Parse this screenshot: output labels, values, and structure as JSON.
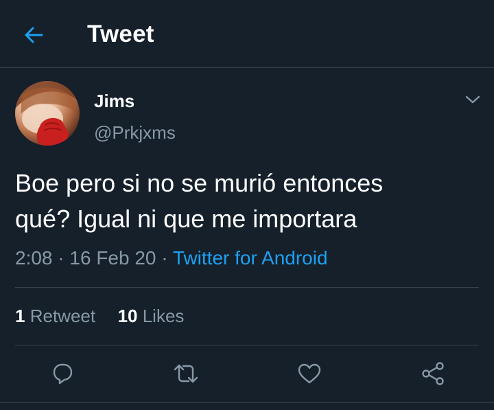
{
  "header": {
    "back_icon": "arrow-left-icon",
    "title": "Tweet"
  },
  "tweet": {
    "author": {
      "name": "Jims",
      "handle": "@Prkjxms",
      "avatar": "avatar-photo"
    },
    "menu_icon": "chevron-down-icon",
    "text_line1": "Boe pero si no se murió entonces",
    "text_line2": "qué? Igual ni que me importara",
    "time": "2:08",
    "dot1": "·",
    "date": "16 Feb 20",
    "dot2": "·",
    "source": "Twitter for Android",
    "retweets_count": "1",
    "retweets_label": "Retweet",
    "likes_count": "10",
    "likes_label": "Likes"
  },
  "actions": {
    "reply_icon": "reply-icon",
    "retweet_icon": "retweet-icon",
    "like_icon": "heart-icon",
    "share_icon": "share-icon"
  },
  "colors": {
    "background": "#15202b",
    "accent": "#1da1f2",
    "secondary_text": "#8899a6",
    "divider": "#38444d"
  }
}
